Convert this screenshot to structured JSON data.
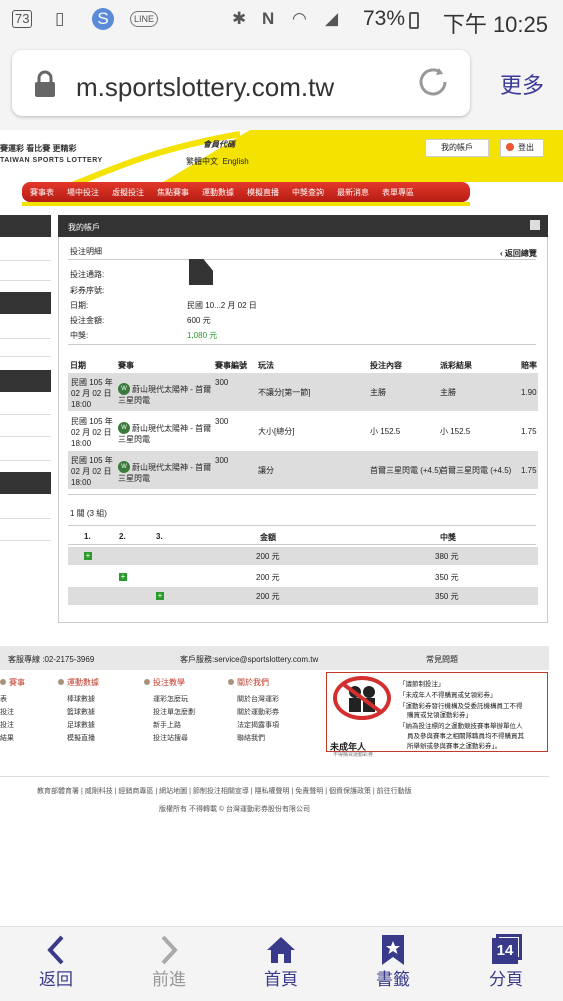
{
  "status_bar": {
    "notification_count": "73",
    "battery": "73%",
    "time": "下午 10:25"
  },
  "browser": {
    "url": "m.sportslottery.com.tw",
    "more_label": "更多"
  },
  "site_header": {
    "top_links": "賽運彩  看比賽  更精彩",
    "logo_en": "TAIWAN SPORTS LOTTERY",
    "member_code": "會員代碼",
    "lang_zh": "繁體中文",
    "lang_en": "English",
    "my_account": "我的帳戶",
    "logout": "登出"
  },
  "nav": [
    "賽事表",
    "場中投注",
    "虛擬投注",
    "焦點賽事",
    "運動數據",
    "模擬直播",
    "中獎查詢",
    "最新消息",
    "表單專區"
  ],
  "panel": {
    "title": "我的帳戶",
    "section": "投注明細",
    "back": "返回總覽"
  },
  "details": [
    {
      "label": "投注通路:",
      "value": ""
    },
    {
      "label": "彩券序號:",
      "value": ""
    },
    {
      "label": "日期:",
      "value": "民國 10...2 月 02 日"
    },
    {
      "label": "投注金額:",
      "value": "600 元"
    },
    {
      "label": "中獎:",
      "value": "1,080 元"
    }
  ],
  "bets_table": {
    "headers": [
      "日期",
      "賽事",
      "賽事編號",
      "玩法",
      "投注內容",
      "派彩結果",
      "賠率"
    ],
    "rows": [
      {
        "date": [
          "民國 105 年",
          "02 月 02 日",
          "18:00"
        ],
        "event": [
          "蔚山現代太陽神 - 首爾",
          "三星閃電"
        ],
        "id": "300",
        "play": "不讓分[第一節]",
        "pick": "主勝",
        "result": "主勝",
        "odds": "1.90"
      },
      {
        "date": [
          "民國 105 年",
          "02 月 02 日",
          "18:00"
        ],
        "event": [
          "蔚山現代太陽神 - 首爾",
          "三星閃電"
        ],
        "id": "300",
        "play": "大小[總分]",
        "pick": "小 152.5",
        "result": "小 152.5",
        "odds": "1.75"
      },
      {
        "date": [
          "民國 105 年",
          "02 月 02 日",
          "18:00"
        ],
        "event": [
          "蔚山現代太陽神 - 首爾",
          "三星閃電"
        ],
        "id": "300",
        "play": "讓分",
        "pick": "首爾三星閃電 (+4.5)",
        "result": "首爾三星閃電 (+4.5)",
        "odds": "1.75"
      }
    ]
  },
  "combo": {
    "title": "1 關 (3 組)",
    "headers": [
      "1.",
      "2.",
      "3.",
      "金額",
      "中獎"
    ],
    "rows": [
      {
        "amount": "200 元",
        "prize": "380 元"
      },
      {
        "amount": "200 元",
        "prize": "350 元"
      },
      {
        "amount": "200 元",
        "prize": "350 元"
      }
    ]
  },
  "footer": {
    "hotline": "客服專線 :02-2175-3969",
    "email": "客戶服務:service@sportslottery.com.tw",
    "faq": "常見問題",
    "columns": [
      {
        "head": "賽事",
        "items": [
          "表",
          "投注",
          "投注",
          "結果"
        ]
      },
      {
        "head": "運動數據",
        "items": [
          "棒球數據",
          "籃球數據",
          "足球數據",
          "模擬直播"
        ]
      },
      {
        "head": "投注教學",
        "items": [
          "運彩怎麼玩",
          "投注單怎麼劃",
          "新手上路",
          "投注站搜尋"
        ]
      },
      {
        "head": "關於我們",
        "items": [
          "關於台灣運彩",
          "關於運動彩券",
          "法定揭露事項",
          "聯絡我們"
        ]
      }
    ],
    "warning_label": "未成年人",
    "warning_sub": "不得購買運動彩券",
    "warnings": [
      "「議節制投注」",
      "「未成年人不得購買或兌領彩券」",
      "「運動彩券發行機構及受委託機構員工不得",
      "購買或兌領運動彩券」",
      "「納為投注標的之運動競技賽事舉辦單位人",
      "員及參與賽事之相關隊職員均不得購買其",
      "所舉辦或參與賽事之運動彩券」。"
    ],
    "links": "教育部體育署 | 威剛科技 | 經銷商專區 | 網站地圖 | 節制投注相關宣導 | 隱私權聲明 | 免責聲明 | 個資保護政策 | 前往行動版",
    "copyright": "版權所有 不得轉載 © 台灣運動彩券股份有限公司"
  },
  "bottom_nav": [
    {
      "label": "返回",
      "icon": "chevron-left-icon"
    },
    {
      "label": "前進",
      "icon": "chevron-right-icon"
    },
    {
      "label": "首頁",
      "icon": "home-icon"
    },
    {
      "label": "書籤",
      "icon": "bookmark-icon"
    },
    {
      "label": "分頁",
      "icon": "tabs-icon",
      "count": "14"
    }
  ]
}
